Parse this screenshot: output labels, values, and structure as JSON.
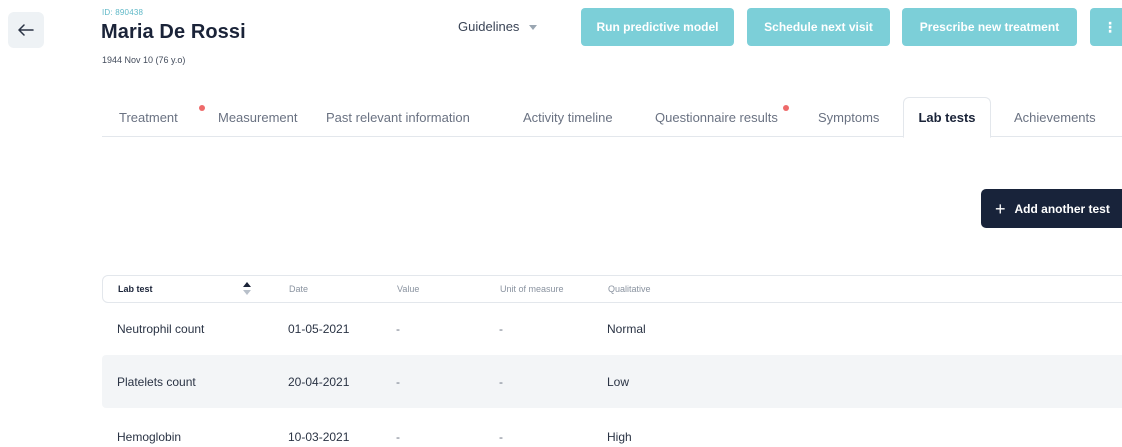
{
  "patient": {
    "id_label": "ID: 890438",
    "name": "Maria De Rossi",
    "dob": "1944 Nov 10 (76 y.o)"
  },
  "header": {
    "guidelines_label": "Guidelines",
    "buttons": {
      "run_model": "Run predictive model",
      "schedule_visit": "Schedule next visit",
      "prescribe": "Prescribe new treatment",
      "more": "⋮"
    }
  },
  "tabs": [
    {
      "label": "Treatment",
      "notification": true
    },
    {
      "label": "Measurement",
      "notification": false
    },
    {
      "label": "Past relevant information",
      "notification": false
    },
    {
      "label": "Activity timeline",
      "notification": false
    },
    {
      "label": "Questionnaire results",
      "notification": true
    },
    {
      "label": "Symptoms",
      "notification": false
    },
    {
      "label": "Lab tests",
      "notification": false,
      "active": true
    },
    {
      "label": "Achievements",
      "notification": false
    }
  ],
  "actions": {
    "add_test": "Add another test"
  },
  "table": {
    "columns": [
      "Lab test",
      "Date",
      "Value",
      "Unit of measure",
      "Qualitative"
    ],
    "rows": [
      [
        "Neutrophil count",
        "01-05-2021",
        "-",
        "-",
        "Normal"
      ],
      [
        "Platelets count",
        "20-04-2021",
        "-",
        "-",
        "Low"
      ],
      [
        "Hemoglobin",
        "10-03-2021",
        "-",
        "-",
        "High"
      ]
    ]
  },
  "colors": {
    "accent_teal": "#7ccfd8",
    "dark_navy": "#18233a",
    "notification_dot": "#ee6a6a",
    "id_text": "#5fb8c7"
  },
  "icons": {
    "back": "arrow-left-icon",
    "more": "more-vertical-icon",
    "add": "plus-icon",
    "sort": "sort-icon"
  }
}
